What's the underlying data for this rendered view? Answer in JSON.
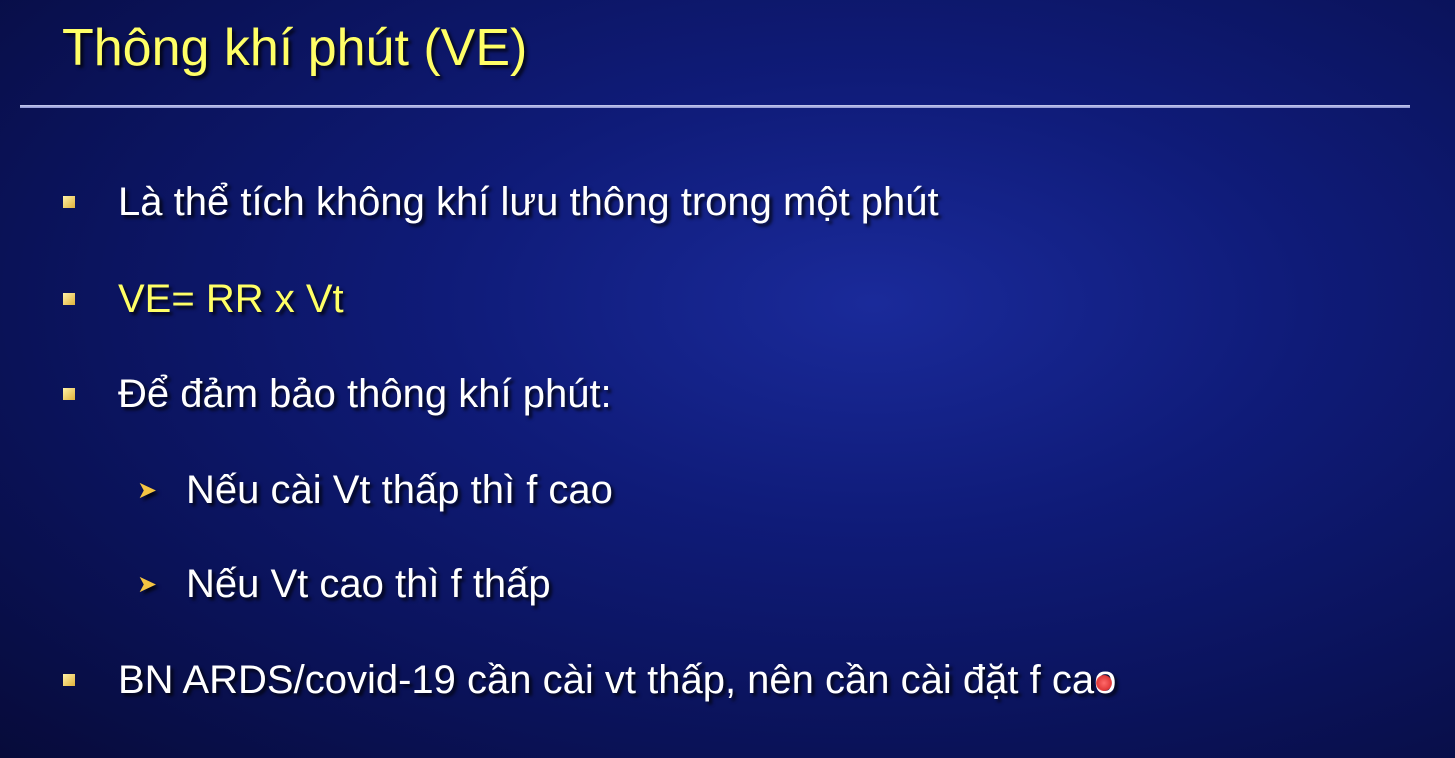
{
  "slide": {
    "title": "Thông khí phút (VE)",
    "bullets": [
      {
        "text": "Là thể tích không khí lưu thông trong một phút",
        "level": 1
      },
      {
        "text": "VE= RR x Vt",
        "level": 1,
        "highlight": "yellow"
      },
      {
        "text": "Để đảm bảo thông khí phút:",
        "level": 1
      },
      {
        "text": "Nếu cài Vt thấp thì f cao",
        "level": 2
      },
      {
        "text": "Nếu Vt cao thì f thấp",
        "level": 2
      },
      {
        "text": "BN ARDS/covid-19 cần cài vt thấp, nên cần cài đặt f cao",
        "level": 1
      }
    ],
    "colors": {
      "title": "#ffff66",
      "text": "#ffffff",
      "highlight": "#ffff66",
      "bullet_marker": "#e0b23a",
      "background": "#0f1b78"
    },
    "icons": {
      "level1_marker": "square-bullet-icon",
      "level2_marker": "arrow-bullet-icon",
      "pointer": "laser-pointer-icon"
    }
  }
}
